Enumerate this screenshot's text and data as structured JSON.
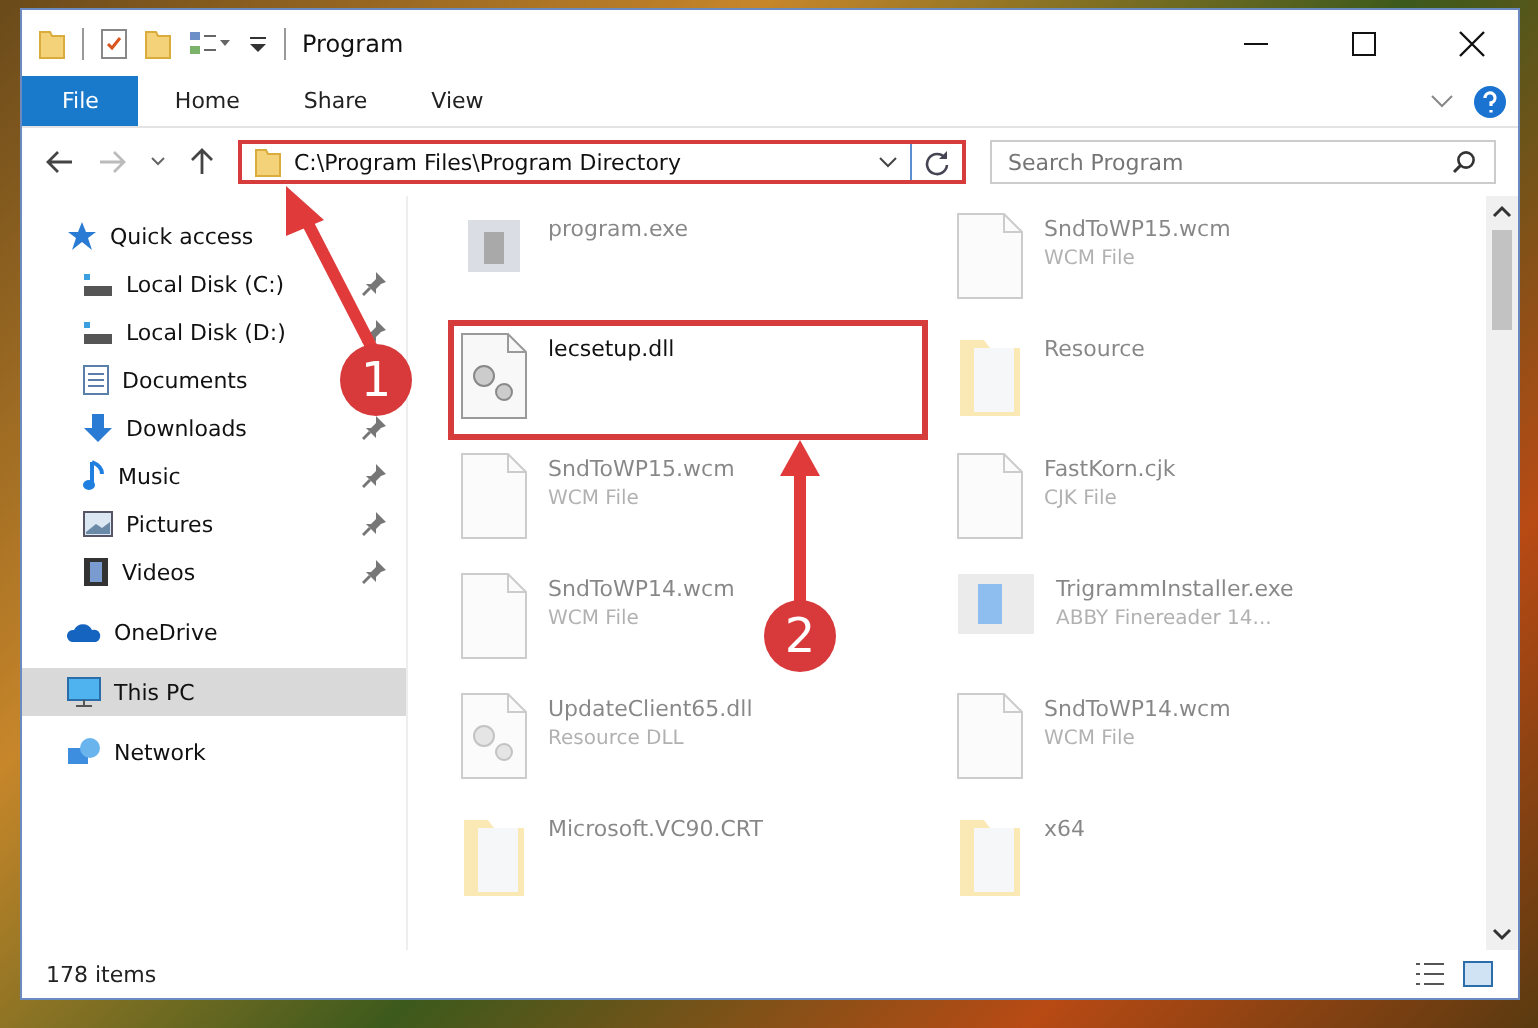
{
  "window": {
    "title": "Program"
  },
  "ribbon_tabs": [
    {
      "label": "File",
      "selected": true
    },
    {
      "label": "Home",
      "selected": false
    },
    {
      "label": "Share",
      "selected": false
    },
    {
      "label": "View",
      "selected": false
    }
  ],
  "address": {
    "value": "C:\\Program Files\\Program Directory",
    "highlighted": true
  },
  "search": {
    "placeholder": "Search Program"
  },
  "sidebar": {
    "items": [
      {
        "label": "Quick access",
        "kind": "star",
        "pinned": false,
        "selected": false,
        "children": [
          {
            "label": "Local Disk (C:)",
            "kind": "disk",
            "pinned": true,
            "selected": false
          },
          {
            "label": "Local Disk (D:)",
            "kind": "disk",
            "pinned": true,
            "selected": false
          },
          {
            "label": "Documents",
            "kind": "documents",
            "pinned": false,
            "selected": false
          },
          {
            "label": "Downloads",
            "kind": "downloads",
            "pinned": true,
            "selected": false
          },
          {
            "label": "Music",
            "kind": "music",
            "pinned": true,
            "selected": false
          },
          {
            "label": "Pictures",
            "kind": "pictures",
            "pinned": true,
            "selected": false
          },
          {
            "label": "Videos",
            "kind": "videos",
            "pinned": true,
            "selected": false
          }
        ]
      },
      {
        "label": "OneDrive",
        "kind": "cloud",
        "pinned": false,
        "selected": false
      },
      {
        "label": "This PC",
        "kind": "pc",
        "pinned": false,
        "selected": true
      },
      {
        "label": "Network",
        "kind": "network",
        "pinned": false,
        "selected": false
      }
    ]
  },
  "files": [
    {
      "name": "program.exe",
      "kind": "exe",
      "highlighted": false
    },
    {
      "name": "SndToWP15.wcm",
      "type": "WCM File",
      "kind": "file",
      "highlighted": false
    },
    {
      "name": "lecsetup.dll",
      "kind": "dll",
      "highlighted": true
    },
    {
      "name": "Resource",
      "kind": "folder",
      "highlighted": false
    },
    {
      "name": "SndToWP15.wcm",
      "type": "WCM File",
      "kind": "file",
      "highlighted": false
    },
    {
      "name": "FastKorn.cjk",
      "type": "CJK File",
      "kind": "file",
      "highlighted": false
    },
    {
      "name": "SndToWP14.wcm",
      "type": "WCM File",
      "kind": "file",
      "highlighted": false
    },
    {
      "name": "TrigrammInstaller.exe",
      "type": "ABBY Finereader 14...",
      "kind": "installer",
      "highlighted": false
    },
    {
      "name": "UpdateClient65.dll",
      "type": "Resource DLL",
      "kind": "dll",
      "highlighted": false
    },
    {
      "name": "SndToWP14.wcm",
      "type": "WCM File",
      "kind": "file",
      "highlighted": false
    },
    {
      "name": "Microsoft.VC90.CRT",
      "kind": "folder",
      "highlighted": false
    },
    {
      "name": "x64",
      "kind": "folder",
      "highlighted": false
    }
  ],
  "annotations": [
    {
      "number": "1"
    },
    {
      "number": "2"
    }
  ],
  "status_bar": {
    "count": "178 items"
  }
}
